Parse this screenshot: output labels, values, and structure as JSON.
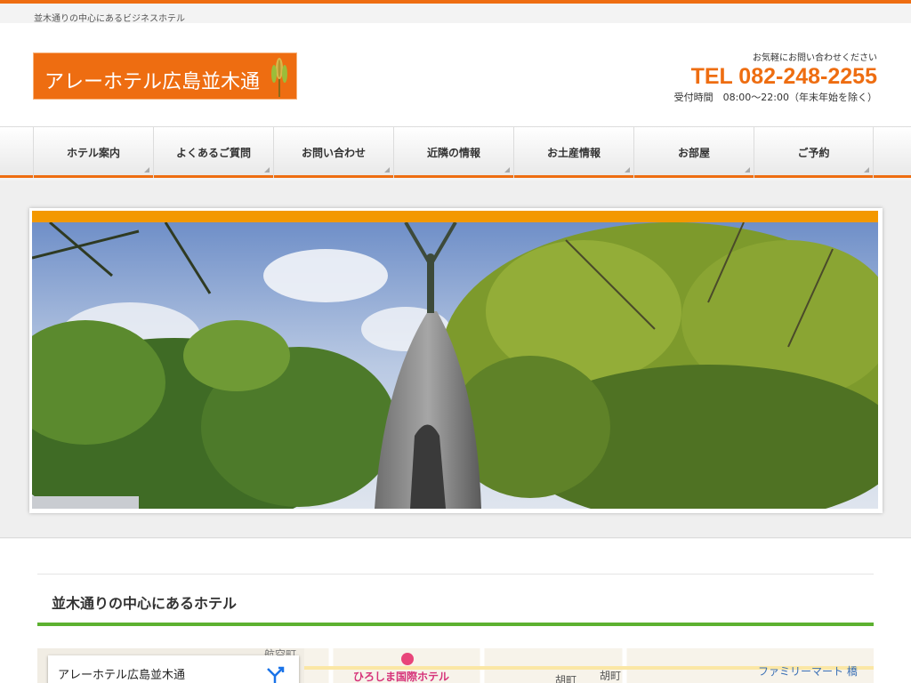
{
  "site": {
    "tagline": "並木通りの中心にあるビジネスホテル",
    "logo_text": "アレーホテル広島並木通"
  },
  "contact": {
    "lead": "お気軽にお問い合わせください",
    "tel": "TEL 082-248-2255",
    "hours": "受付時間　08:00～22:00（年末年始を除く）"
  },
  "nav": {
    "items": [
      {
        "label": "ホテル案内"
      },
      {
        "label": "よくあるご質問"
      },
      {
        "label": "お問い合わせ"
      },
      {
        "label": "近隣の情報"
      },
      {
        "label": "お土産情報"
      },
      {
        "label": "お部屋"
      },
      {
        "label": "ご予約"
      }
    ]
  },
  "section": {
    "title": "並木通りの中心にあるホテル"
  },
  "map": {
    "card_title": "アレーホテル広島並木通",
    "labels": [
      "ひろしま国際ホテル",
      "胡町",
      "胡町",
      "ファミリーマート 橋",
      "航空町"
    ]
  },
  "colors": {
    "accent": "#ee6d11",
    "hero_bar": "#f39800",
    "section_underline": "#5cb130"
  }
}
